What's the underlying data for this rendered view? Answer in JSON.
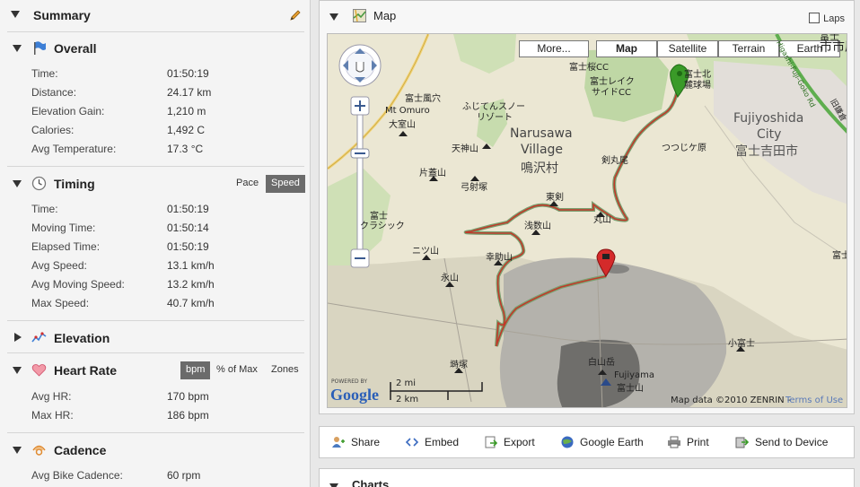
{
  "summary": {
    "title": "Summary",
    "overall": {
      "title": "Overall",
      "rows": [
        {
          "label": "Time:",
          "value": "01:50:19"
        },
        {
          "label": "Distance:",
          "value": "24.17 km"
        },
        {
          "label": "Elevation Gain:",
          "value": "1,210 m"
        },
        {
          "label": "Calories:",
          "value": "1,492 C"
        },
        {
          "label": "Avg Temperature:",
          "value": "17.3 °C"
        }
      ]
    },
    "timing": {
      "title": "Timing",
      "toggle_pace": "Pace",
      "toggle_speed": "Speed",
      "rows": [
        {
          "label": "Time:",
          "value": "01:50:19"
        },
        {
          "label": "Moving Time:",
          "value": "01:50:14"
        },
        {
          "label": "Elapsed Time:",
          "value": "01:50:19"
        },
        {
          "label": "Avg Speed:",
          "value": "13.1 km/h"
        },
        {
          "label": "Avg Moving Speed:",
          "value": "13.2 km/h"
        },
        {
          "label": "Max Speed:",
          "value": "40.7 km/h"
        }
      ]
    },
    "elevation": {
      "title": "Elevation"
    },
    "heart_rate": {
      "title": "Heart Rate",
      "toggle_bpm": "bpm",
      "toggle_pct": "% of Max",
      "toggle_zones": "Zones",
      "rows": [
        {
          "label": "Avg HR:",
          "value": "170 bpm"
        },
        {
          "label": "Max HR:",
          "value": "186 bpm"
        }
      ]
    },
    "cadence": {
      "title": "Cadence",
      "rows": [
        {
          "label": "Avg Bike Cadence:",
          "value": "60 rpm"
        }
      ]
    }
  },
  "map": {
    "title": "Map",
    "laps_label": "Laps",
    "types": {
      "more": "More...",
      "map": "Map",
      "satellite": "Satellite",
      "terrain": "Terrain",
      "earth": "Earth"
    },
    "labels": {
      "fuji_fuuketsu": "富士風穴",
      "mt_omuro": "Mt Omuro",
      "omuroyama": "大室山",
      "snow_resort_1": "ふじてんスノー",
      "snow_resort_2": "リゾート",
      "narusawa": "Narusawa",
      "village": "Village",
      "narusawa_jp": "鳴沢村",
      "tenjinyama": "天神山",
      "katakurayama": "片蓋山",
      "yumiizuka": "弓射塚",
      "fuji_classic_1": "富士",
      "fuji_classic_2": "クラシック",
      "futatsuyama": "ニツ山",
      "eiyama": "永山",
      "kohsukeyama": "幸助山",
      "touken": "東剣",
      "asakusayama": "浅数山",
      "maruyama": "丸山",
      "kenmarubi": "剣丸尾",
      "tsutsujigahara": "つつじケ原",
      "fujizakura_cc": "富士桜CC",
      "fuji_lake_cc_1": "富士レイク",
      "fuji_lake_cc_2": "サイドCC",
      "fujikita_1": "富士北",
      "fujikita_2": "麓球場",
      "fujiyoshida": "Fujiyoshida",
      "city": "City",
      "fujiyoshida_jp": "富士吉田市",
      "road_name": "Higashi-Fuji-Goko Rd",
      "road_old": "旧鎌倉",
      "fuji_jp_top": "富士",
      "hakusandake": "白山岳",
      "fujiyama": "Fujiyama",
      "fujisan": "富士山",
      "kofuji": "小富士",
      "tsuka": "塒塚",
      "fuji_right": "富士",
      "ichihara": "市市原"
    },
    "scale_mi": "2 mi",
    "scale_km": "2 km",
    "powered_by": "POWERED BY",
    "google": "Google",
    "attribution": "Map data ©2010 ZENRIN -",
    "terms": "Terms of Use"
  },
  "toolbar": {
    "share": "Share",
    "embed": "Embed",
    "export": "Export",
    "google_earth": "Google Earth",
    "print": "Print",
    "send_to_device": "Send to Device"
  },
  "charts": {
    "title": "Charts"
  }
}
